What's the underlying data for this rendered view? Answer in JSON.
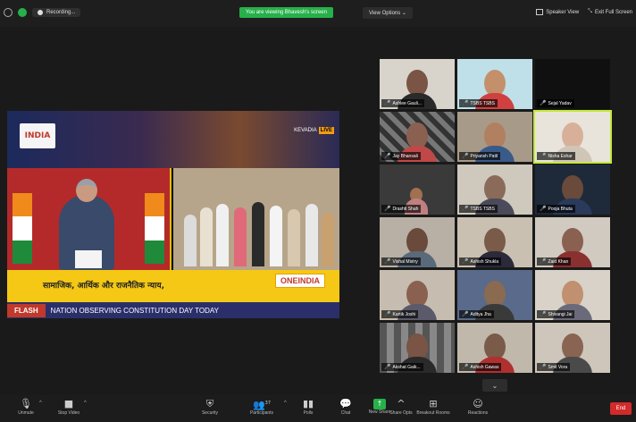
{
  "topbar": {
    "recording_label": "Recording...",
    "share_banner": "You are viewing Bhavesh's screen",
    "view_options": "View Options",
    "speaker_view": "Speaker View",
    "exit_full_screen": "Exit Full Screen"
  },
  "shared_screen": {
    "channel_logo": "INDIA",
    "location_label": "KEVADIA",
    "live_badge": "LIVE",
    "banner_hindi": "सामाजिक, आर्थिक और राजनैतिक न्याय,",
    "brand_logo": "ONEINDIA",
    "flash_label": "FLASH",
    "ticker_text": "NATION OBSERVING CONSTITUTION DAY TODAY"
  },
  "participants": [
    {
      "name": "Ashlee Gauli..."
    },
    {
      "name": "TSBS TSBS"
    },
    {
      "name": "Sejal Yadav"
    },
    {
      "name": "Jay Bhansali"
    },
    {
      "name": "Priyansh Patil"
    },
    {
      "name": "Nisha Eshar"
    },
    {
      "name": "Drashti Shah"
    },
    {
      "name": "TSBS TSBS"
    },
    {
      "name": "Pooja Bhuta"
    },
    {
      "name": "Vishal Mistry"
    },
    {
      "name": "Ashish Shukla"
    },
    {
      "name": "Zaid Khan"
    },
    {
      "name": "Kartik Joshi"
    },
    {
      "name": "Aditya Jha"
    },
    {
      "name": "Shivangi Jai"
    },
    {
      "name": "Akshat Gaik..."
    },
    {
      "name": "Ashish Gawas"
    },
    {
      "name": "Smit Vora"
    }
  ],
  "toolbar": {
    "unmute": "Unmute",
    "stop_video": "Stop Video",
    "security": "Security",
    "participants": "Participants",
    "participant_count": "37",
    "polls": "Polls",
    "chat": "Chat",
    "new_share": "New Share",
    "share_options": "Share Opts",
    "more": "More",
    "breakout_rooms": "Breakout Rooms",
    "reactions": "Reactions",
    "end": "End"
  },
  "colors": {
    "share_green": "#27b04a",
    "end_red": "#d32a2a",
    "active_speaker": "#c5e83a",
    "banner_yellow": "#f4c814"
  }
}
